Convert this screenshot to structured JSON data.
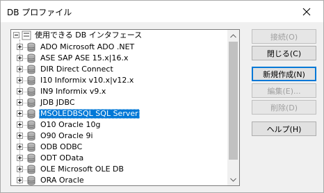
{
  "window": {
    "title": "DB プロファイル"
  },
  "tree": {
    "root_label": "使用できる DB インタフェース",
    "items": [
      {
        "label": "ADO Microsoft ADO .NET",
        "selected": false
      },
      {
        "label": "ASE SAP ASE 15.x|16.x",
        "selected": false
      },
      {
        "label": "DIR Direct Connect",
        "selected": false
      },
      {
        "label": "I10 Informix v10.x|v12.x",
        "selected": false
      },
      {
        "label": "IN9 Informix v9.x",
        "selected": false
      },
      {
        "label": "JDB JDBC",
        "selected": false
      },
      {
        "label": "MSOLEDBSQL SQL Server",
        "selected": true
      },
      {
        "label": "O10 Oracle 10g",
        "selected": false
      },
      {
        "label": "O90 Oracle 9i",
        "selected": false
      },
      {
        "label": "ODB ODBC",
        "selected": false
      },
      {
        "label": "ODT OData",
        "selected": false
      },
      {
        "label": "OLE Microsoft OLE DB",
        "selected": false
      },
      {
        "label": "ORA Oracle",
        "selected": false
      }
    ]
  },
  "buttons": {
    "connect": "接続(O)",
    "close": "閉じる(C)",
    "new": "新規作成(N)",
    "edit": "編集(E)...",
    "delete": "削除(D)",
    "help": "ヘルプ(H)"
  }
}
